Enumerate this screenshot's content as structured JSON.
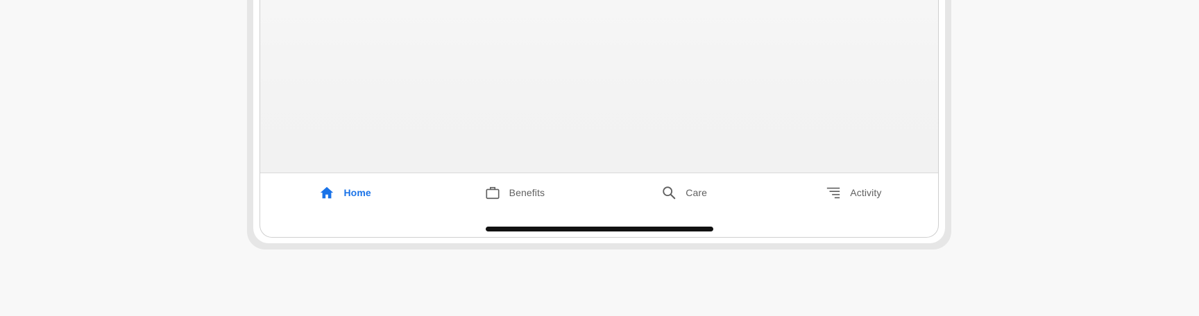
{
  "tabs": [
    {
      "id": "home",
      "label": "Home",
      "icon": "home-icon",
      "active": true
    },
    {
      "id": "benefits",
      "label": "Benefits",
      "icon": "briefcase-icon",
      "active": false
    },
    {
      "id": "care",
      "label": "Care",
      "icon": "search-icon",
      "active": false
    },
    {
      "id": "activity",
      "label": "Activity",
      "icon": "list-icon",
      "active": false
    }
  ],
  "colors": {
    "accent": "#1a73e8",
    "inactive": "#5f5f5f",
    "background": "#f8f8f8",
    "bezel": "#e6e6e6"
  }
}
